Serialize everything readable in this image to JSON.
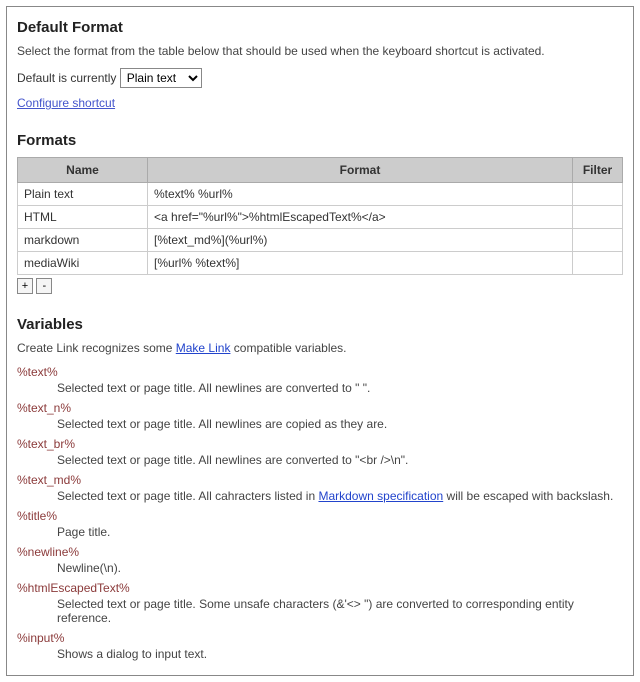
{
  "defaultFormat": {
    "heading": "Default Format",
    "description": "Select the format from the table below that should be used when the keyboard shortcut is activated.",
    "label": "Default is currently",
    "selected": "Plain text",
    "options": [
      "Plain text",
      "HTML",
      "markdown",
      "mediaWiki"
    ],
    "configureLink": "Configure shortcut"
  },
  "formats": {
    "heading": "Formats",
    "columns": {
      "name": "Name",
      "format": "Format",
      "filter": "Filter"
    },
    "rows": [
      {
        "name": "Plain text",
        "format": "%text% %url%",
        "filter": ""
      },
      {
        "name": "HTML",
        "format": "<a href=\"%url%\">%htmlEscapedText%</a>",
        "filter": ""
      },
      {
        "name": "markdown",
        "format": "[%text_md%](%url%)",
        "filter": ""
      },
      {
        "name": "mediaWiki",
        "format": "[%url% %text%]",
        "filter": ""
      }
    ],
    "addLabel": "+",
    "removeLabel": "-"
  },
  "variables": {
    "heading": "Variables",
    "intro_pre": "Create Link recognizes some ",
    "intro_link": "Make Link",
    "intro_post": " compatible variables.",
    "items": [
      {
        "name": "%text%",
        "desc_pre": "Selected text or page title. All newlines are converted to \" \".",
        "desc_link": "",
        "desc_post": ""
      },
      {
        "name": "%text_n%",
        "desc_pre": "Selected text or page title. All newlines are copied as they are.",
        "desc_link": "",
        "desc_post": ""
      },
      {
        "name": "%text_br%",
        "desc_pre": "Selected text or page title. All newlines are converted to \"<br />\\n\".",
        "desc_link": "",
        "desc_post": ""
      },
      {
        "name": "%text_md%",
        "desc_pre": "Selected text or page title. All cahracters listed in ",
        "desc_link": "Markdown specification",
        "desc_post": " will be escaped with backslash."
      },
      {
        "name": "%title%",
        "desc_pre": "Page title.",
        "desc_link": "",
        "desc_post": ""
      },
      {
        "name": "%newline%",
        "desc_pre": "Newline(\\n).",
        "desc_link": "",
        "desc_post": ""
      },
      {
        "name": "%htmlEscapedText%",
        "desc_pre": "Selected text or page title. Some unsafe characters (&'<> \") are converted to corresponding entity reference.",
        "desc_link": "",
        "desc_post": ""
      },
      {
        "name": "%input%",
        "desc_pre": "Shows a dialog to input text.",
        "desc_link": "",
        "desc_post": ""
      }
    ]
  }
}
